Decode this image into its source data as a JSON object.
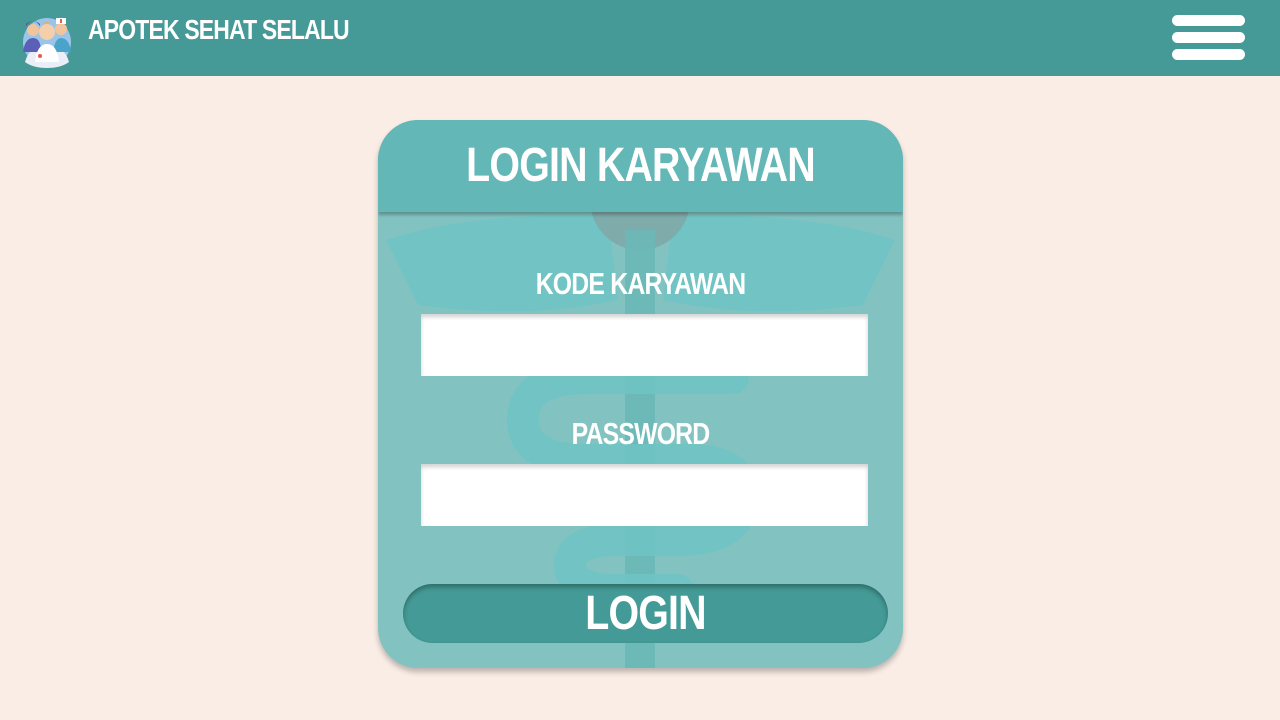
{
  "header": {
    "brand": "APOTEK SEHAT SELALU",
    "logo_icon": "pharmacy-staff-logo",
    "menu_icon": "hamburger-menu-icon",
    "background_color": "#459a97"
  },
  "login_card": {
    "title": "LOGIN KARYAWAN",
    "background_icon": "caduceus-watermark",
    "employee_code": {
      "label": "KODE KARYAWAN",
      "value": "",
      "placeholder": ""
    },
    "password": {
      "label": "PASSWORD",
      "value": "",
      "placeholder": ""
    },
    "submit_label": "LOGIN"
  },
  "colors": {
    "page_background": "#faede6",
    "card_background": "#82c3c2",
    "card_header": "#63b7b6",
    "button": "#449a96"
  }
}
